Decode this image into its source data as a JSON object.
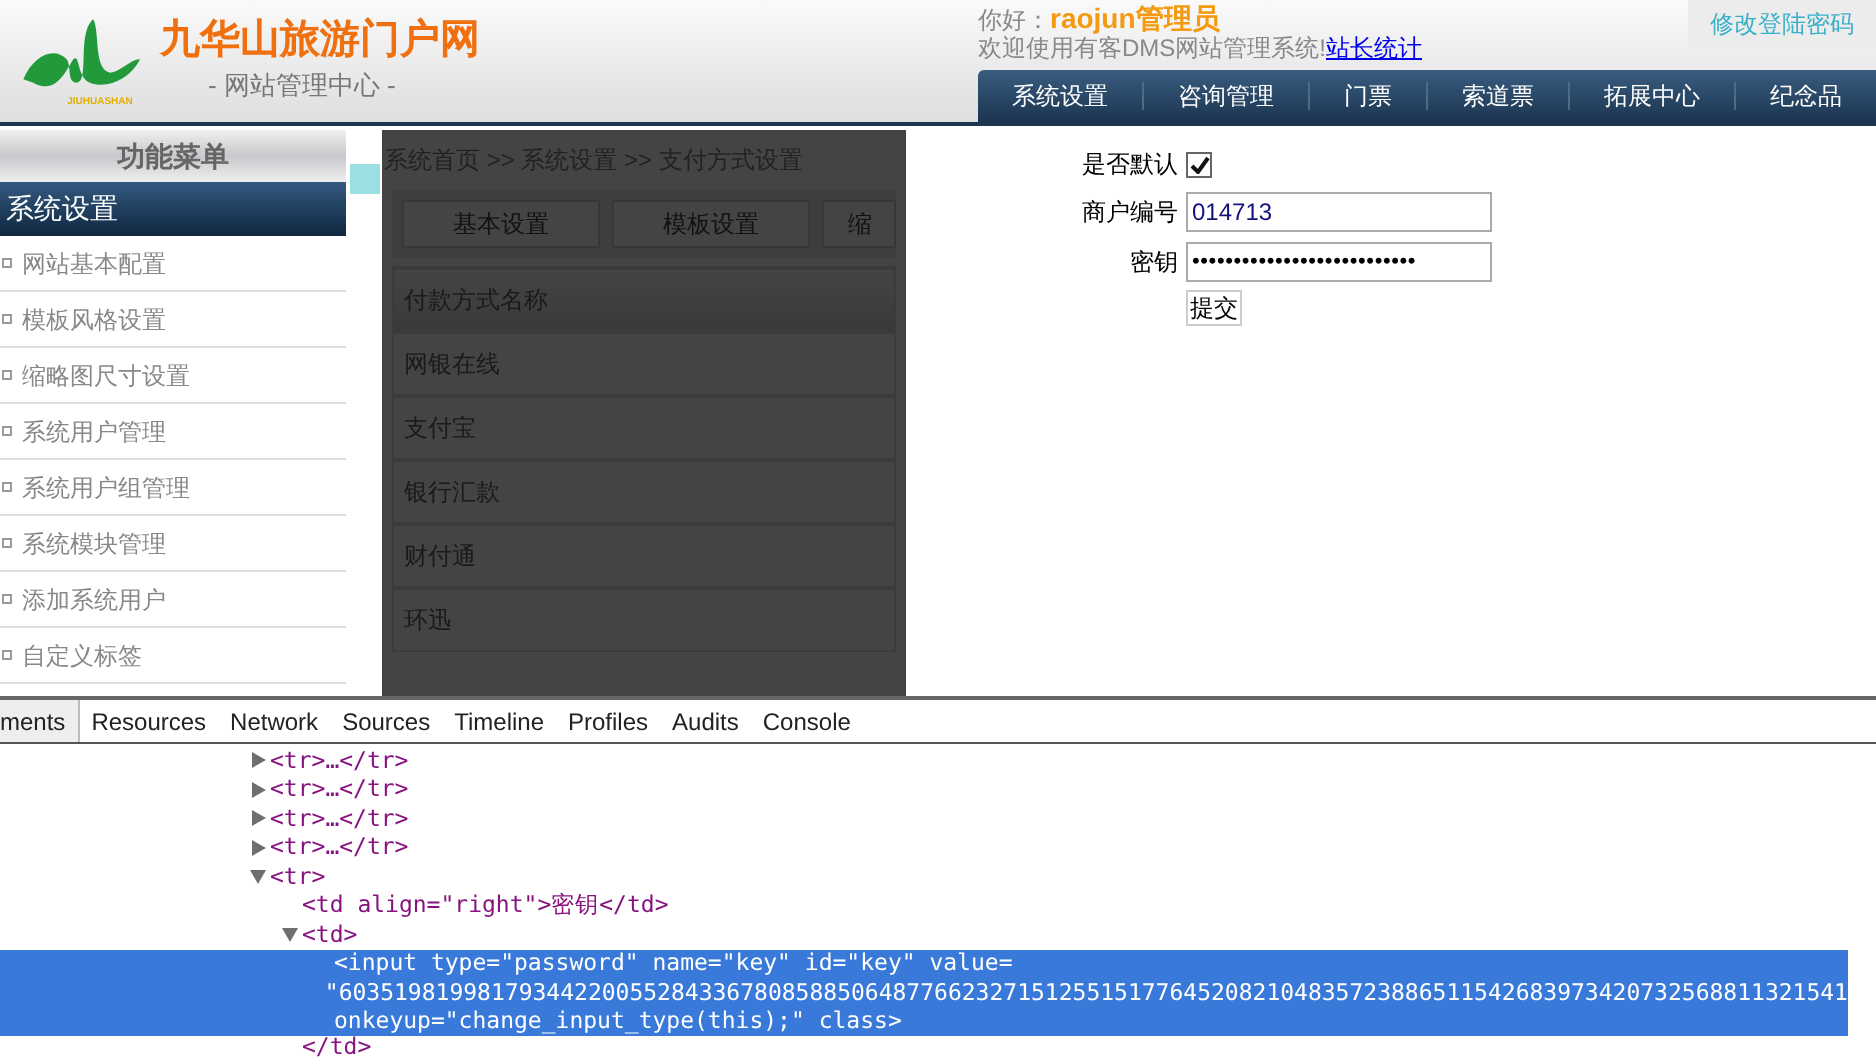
{
  "header": {
    "logo_title": "九华山旅游门户网",
    "logo_caption": "JIUHUASHAN",
    "logo_subtitle": "- 网站管理中心 -",
    "greeting": "你好：",
    "user": "raojun管理员",
    "welcome": "欢迎使用有客DMS网站管理系统!",
    "stats_link": "站长统计",
    "change_password": "修改登陆密码"
  },
  "nav": [
    {
      "label": "系统设置",
      "selected": false
    },
    {
      "label": "咨询管理",
      "selected": false
    },
    {
      "label": "门票",
      "selected": false
    },
    {
      "label": "索道票",
      "selected": false
    },
    {
      "label": "拓展中心",
      "selected": false
    },
    {
      "label": "纪念品",
      "selected": false
    }
  ],
  "sidebar": {
    "title": "功能菜单",
    "section": "系统设置",
    "items": [
      "网站基本配置",
      "模板风格设置",
      "缩略图尺寸设置",
      "系统用户管理",
      "系统用户组管理",
      "系统模块管理",
      "添加系统用户",
      "自定义标签"
    ]
  },
  "panel": {
    "breadcrumb": "系统首页 >> 系统设置 >> 支付方式设置",
    "tabs": [
      "基本设置",
      "模板设置",
      "缩"
    ],
    "table_header": "付款方式名称",
    "rows": [
      "网银在线",
      "支付宝",
      "银行汇款",
      "财付通",
      "环迅"
    ]
  },
  "form": {
    "default_label": "是否默认",
    "default_checked": true,
    "merchant_label": "商户编号",
    "merchant_value": "014713",
    "key_label": "密钥",
    "key_masked": "•••••••••••••••••••••••••••",
    "submit": "提交"
  },
  "devtools": {
    "tabs": [
      {
        "label": "ments",
        "selected": true
      },
      {
        "label": "Resources",
        "selected": false
      },
      {
        "label": "Network",
        "selected": false
      },
      {
        "label": "Sources",
        "selected": false
      },
      {
        "label": "Timeline",
        "selected": false
      },
      {
        "label": "Profiles",
        "selected": false
      },
      {
        "label": "Audits",
        "selected": false
      },
      {
        "label": "Console",
        "selected": false
      }
    ],
    "tree": [
      {
        "kind": "node",
        "text": "<tr>…</tr>",
        "expanded": false,
        "selected": false
      },
      {
        "kind": "node",
        "text": "<tr>…</tr>",
        "expanded": false,
        "selected": false
      },
      {
        "kind": "node",
        "text": "<tr>…</tr>",
        "expanded": false,
        "selected": false
      },
      {
        "kind": "node",
        "text": "<tr>…</tr>",
        "expanded": false,
        "selected": false
      },
      {
        "kind": "node",
        "text": "<tr>",
        "expanded": true,
        "selected": false,
        "children": [
          {
            "kind": "leaf",
            "text": "<td align=\"right\">密钥</td>",
            "selected": false
          },
          {
            "kind": "node",
            "text": "<td>",
            "expanded": true,
            "selected": false,
            "close": "</td>",
            "children": [
              {
                "kind": "leaf",
                "text": "<input type=\"password\" name=\"key\" id=\"key\" value=",
                "selected": true
              },
              {
                "kind": "leaf",
                "text": "\"6035198199817934422005528433678085885064877662327151255151776452082104835723886511542683973420732568811321541",
                "selected": true
              },
              {
                "kind": "leaf",
                "text": "onkeyup=\"change_input_type(this);\" class>",
                "selected": true
              }
            ]
          }
        ]
      }
    ]
  }
}
